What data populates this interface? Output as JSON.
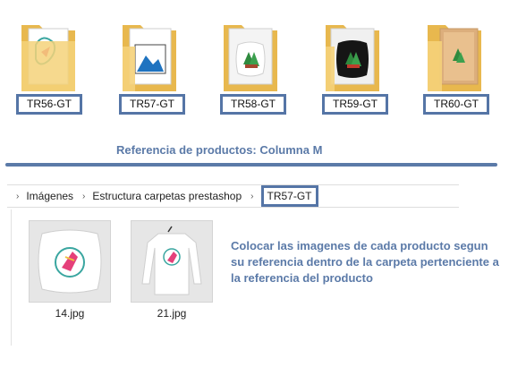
{
  "folders": [
    {
      "label": "TR56-GT",
      "thumb": "mug-print"
    },
    {
      "label": "TR57-GT",
      "thumb": "framed-mountain-print"
    },
    {
      "label": "TR58-GT",
      "thumb": "white-cushion-print"
    },
    {
      "label": "TR59-GT",
      "thumb": "black-cushion-print"
    },
    {
      "label": "TR60-GT",
      "thumb": "cork-board-print"
    }
  ],
  "caption": "Referencia de productos: Columna M",
  "breadcrumb": {
    "items": [
      "Imágenes",
      "Estructura carpetas prestashop"
    ],
    "current": "TR57-GT"
  },
  "files": [
    {
      "name": "14.jpg",
      "thumb": "cushion"
    },
    {
      "name": "21.jpg",
      "thumb": "long-sleeve-shirt"
    }
  ],
  "instructions": "Colocar las imagenes de cada producto segun su referencia dentro de la carpeta pertenciente a la referencia del producto",
  "colors": {
    "accent": "#5b7aa8",
    "box_border": "#5575a6",
    "folder": "#f5d27a"
  }
}
